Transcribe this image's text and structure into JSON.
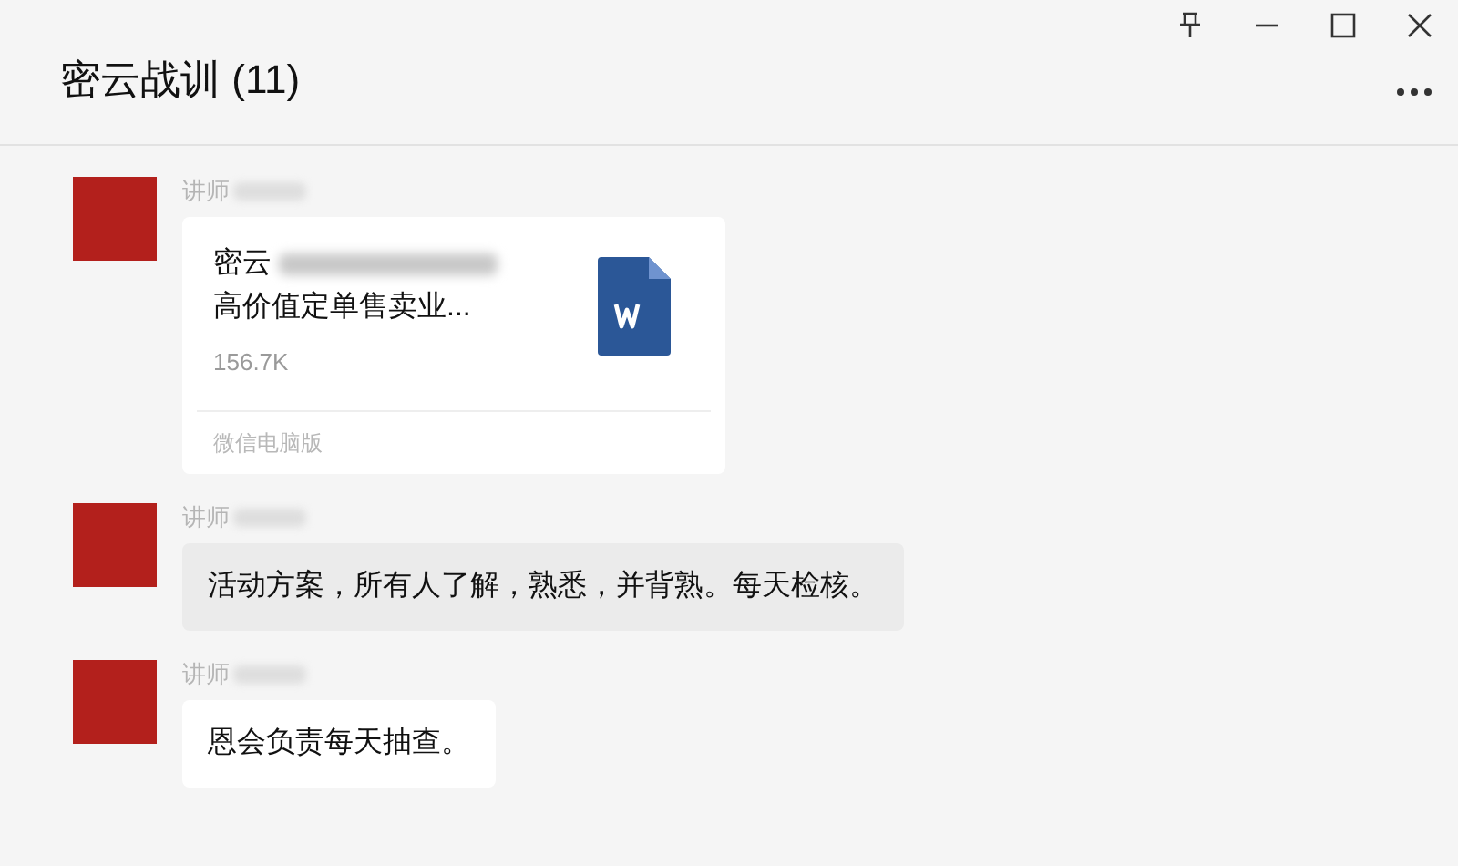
{
  "window": {
    "title": "密云战训 (11)"
  },
  "messages": [
    {
      "kind": "file",
      "sender": "讲师",
      "file_name_lines": [
        "密云",
        "高价值定单售卖业..."
      ],
      "file_size": "156.7K",
      "source": "微信电脑版",
      "highlighted": false
    },
    {
      "kind": "text",
      "sender": "讲师",
      "text": "活动方案，所有人了解，熟悉，并背熟。每天检核。",
      "highlighted": true
    },
    {
      "kind": "text",
      "sender": "讲师",
      "text": "恩会负责每天抽查。",
      "highlighted": false
    }
  ]
}
